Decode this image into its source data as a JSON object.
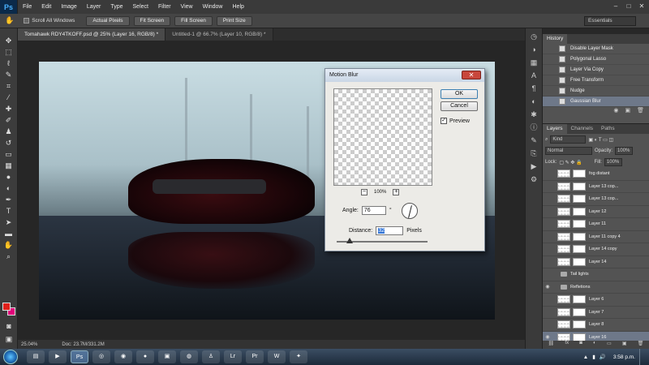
{
  "app": {
    "logo": "Ps"
  },
  "menu": [
    "File",
    "Edit",
    "Image",
    "Layer",
    "Type",
    "Select",
    "Filter",
    "View",
    "Window",
    "Help"
  ],
  "window_controls": [
    "minimize-icon",
    "maximize-icon",
    "close-icon"
  ],
  "options_bar": {
    "scroll_all": "Scroll All Windows",
    "buttons": [
      "Actual Pixels",
      "Fit Screen",
      "Fill Screen",
      "Print Size"
    ],
    "workspace": "Essentials"
  },
  "tabs": [
    {
      "label": "Tomahawk RDY4TKOFF.psd @ 25% (Layer 16, RGB/8) *",
      "active": true
    },
    {
      "label": "Untitled-1 @ 66.7% (Layer 10, RGB/8) *",
      "active": false
    }
  ],
  "status": {
    "zoom": "25.04%",
    "doc": "Doc: 23.7M/331.2M"
  },
  "dialog": {
    "title": "Motion Blur",
    "close": "✕",
    "ok": "OK",
    "cancel": "Cancel",
    "preview_label": "Preview",
    "preview_checked": "✓",
    "zoom_out": "−",
    "zoom_level": "100%",
    "zoom_in": "+",
    "angle_label": "Angle:",
    "angle_value": "76",
    "angle_unit": "°",
    "distance_label": "Distance:",
    "distance_value": "32",
    "distance_unit": "Pixels"
  },
  "history": {
    "tabs": [
      "History"
    ],
    "items": [
      {
        "label": "Disable Layer Mask",
        "selected": false
      },
      {
        "label": "Polygonal Lasso",
        "selected": false
      },
      {
        "label": "Layer Via Copy",
        "selected": false
      },
      {
        "label": "Free Transform",
        "selected": false
      },
      {
        "label": "Nudge",
        "selected": false
      },
      {
        "label": "Gaussian Blur",
        "selected": true
      }
    ]
  },
  "layers": {
    "tabs": [
      "Layers",
      "Channels",
      "Paths"
    ],
    "kind": "Kind",
    "blend_mode": "Normal",
    "opacity_label": "Opacity:",
    "opacity_value": "100%",
    "lock_label": "Lock:",
    "fill_label": "Fill:",
    "fill_value": "100%",
    "rows": [
      {
        "name": "fog distant",
        "type": "layer",
        "visible": false,
        "selected": false
      },
      {
        "name": "Layer 13 cop...",
        "type": "layer",
        "visible": false,
        "selected": false
      },
      {
        "name": "Layer 13 cop...",
        "type": "layer",
        "visible": false,
        "selected": false
      },
      {
        "name": "Layer 12",
        "type": "layer",
        "visible": false,
        "selected": false
      },
      {
        "name": "Layer 11",
        "type": "layer",
        "visible": false,
        "selected": false
      },
      {
        "name": "Layer 11 copy 4",
        "type": "layer",
        "visible": false,
        "selected": false
      },
      {
        "name": "Layer 14 copy",
        "type": "layer",
        "visible": false,
        "selected": false
      },
      {
        "name": "Layer 14",
        "type": "layer",
        "visible": false,
        "selected": false
      },
      {
        "name": "Tail lights",
        "type": "group",
        "visible": false,
        "selected": false
      },
      {
        "name": "Refletions",
        "type": "group",
        "visible": true,
        "selected": false
      },
      {
        "name": "Layer 6",
        "type": "layer",
        "visible": false,
        "selected": false
      },
      {
        "name": "Layer 7",
        "type": "layer",
        "visible": false,
        "selected": false
      },
      {
        "name": "Layer 8",
        "type": "layer",
        "visible": false,
        "selected": false
      },
      {
        "name": "Layer 16",
        "type": "layer",
        "visible": true,
        "selected": true
      }
    ]
  },
  "taskbar": {
    "apps": [
      "folder",
      "media",
      "ps",
      "browser",
      "steam",
      "app",
      "chat",
      "chrome",
      "figure",
      "lr",
      "pr",
      "word",
      "dropbox"
    ],
    "clock": "3:58 p.m."
  },
  "colors": {
    "foreground": "#e0201a",
    "background": "#e1007a",
    "selection": "#6e7889"
  }
}
